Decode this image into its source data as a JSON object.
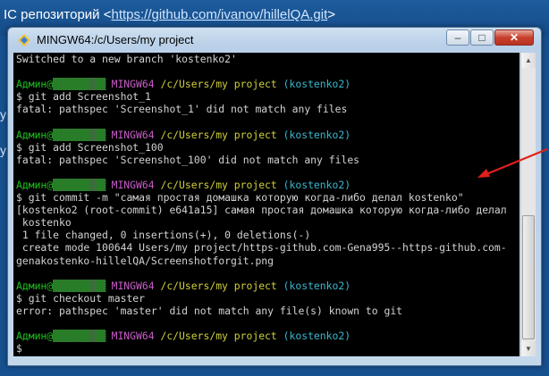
{
  "background": {
    "header_prefix": "IC репозиторий <",
    "header_link": "https://github.com/ivanov/hillelQA.git",
    "header_suffix": ">"
  },
  "window": {
    "title": "MINGW64:/c/Users/my project",
    "controls": {
      "minimize": "–",
      "maximize": "□",
      "close": "✕"
    }
  },
  "terminal": {
    "prompt": {
      "user": "Админ@",
      "host_hidden": "▒▒▒▒▒▒▒-▒▒",
      "env": "MINGW64",
      "path": "/c/Users/my project",
      "branch": "(kostenko2)"
    },
    "lines": {
      "l0": "Switched to a new branch 'kostenko2'",
      "l1": "$ git add Screenshot_1",
      "l2": "fatal: pathspec 'Screenshot_1' did not match any files",
      "l3": "$ git add Screenshot_100",
      "l4": "fatal: pathspec 'Screenshot_100' did not match any files",
      "l5": "$ git commit -m \"самая простая домашка которую когда-либо делал kostenko\"",
      "l6": "[kostenko2 (root-commit) e641a15] самая простая домашка которую когда-либо делал",
      "l7": " kostenko",
      "l8": " 1 file changed, 0 insertions(+), 0 deletions(-)",
      "l9": " create mode 100644 Users/my project/https-github.com-Gena995--https-github.com-",
      "l10": "genakostenko-hillelQA/Screenshotforgit.png",
      "l11": "$ git checkout master",
      "l12": "error: pathspec 'master' did not match any file(s) known to git",
      "l13": "$ "
    }
  },
  "colors": {
    "prompt_user": "#1ec21e",
    "prompt_env": "#c65ec6",
    "prompt_path": "#cfcf3a",
    "prompt_branch": "#39b8d0",
    "annotation_arrow": "#e0201a"
  }
}
